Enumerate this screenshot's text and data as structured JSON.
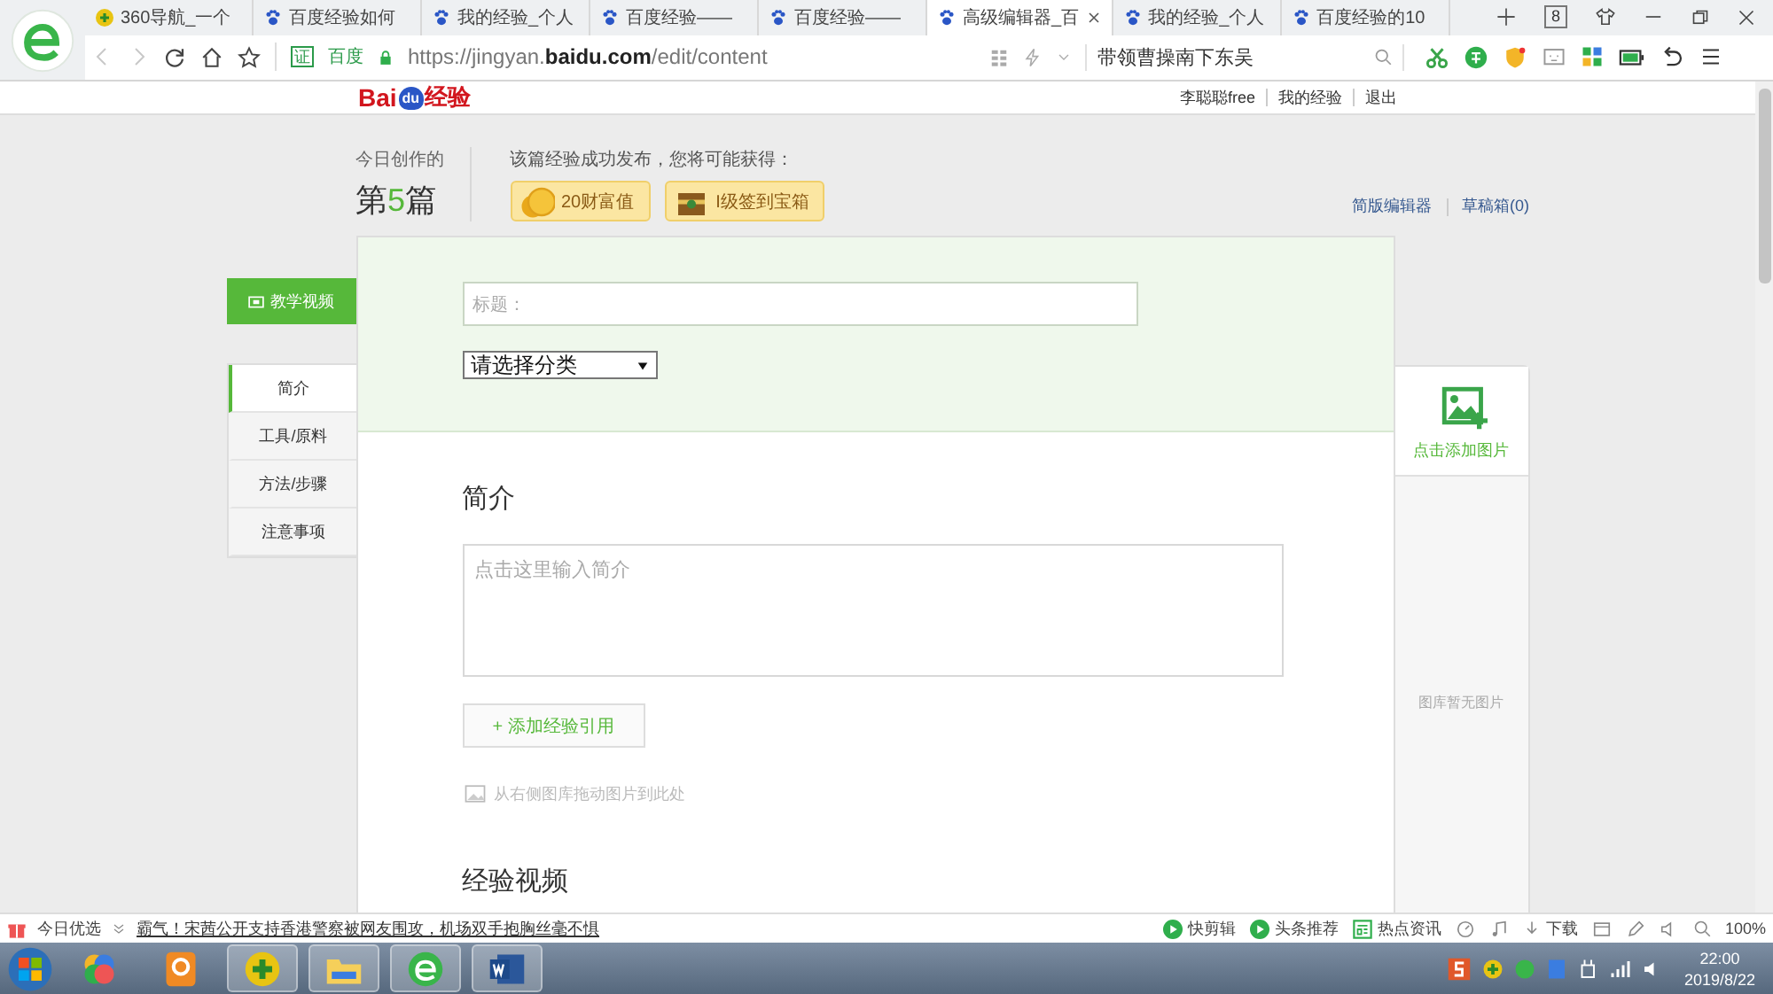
{
  "browser": {
    "tabs": [
      {
        "title": "360导航_一个",
        "selected": false,
        "kind": "navigator"
      },
      {
        "title": "百度经验如何",
        "selected": false,
        "kind": "baidu"
      },
      {
        "title": "我的经验_个人",
        "selected": false,
        "kind": "baidu"
      },
      {
        "title": "百度经验——",
        "selected": false,
        "kind": "baidu"
      },
      {
        "title": "百度经验——",
        "selected": false,
        "kind": "baidu"
      },
      {
        "title": "高级编辑器_百",
        "selected": true,
        "kind": "baidu"
      },
      {
        "title": "我的经验_个人",
        "selected": false,
        "kind": "baidu"
      },
      {
        "title": "百度经验的10",
        "selected": false,
        "kind": "baidu"
      }
    ],
    "tab_count": "8",
    "nav": {
      "back_disabled": true,
      "forward_disabled": true
    },
    "address": {
      "site_badge": "证",
      "site_name": "百度",
      "url": "https://jingyan.**baidu.com**/edit/content"
    },
    "search": {
      "value": "带领曹操南下东吴"
    }
  },
  "header": {
    "logo": {
      "left": "Bai",
      "paw": "du",
      "right": "经验"
    },
    "user_links": [
      "李聪聪free",
      "我的经验",
      "退出"
    ]
  },
  "creation": {
    "label": "今日创作的",
    "count_prefix": "第",
    "count": "5",
    "count_suffix": "篇",
    "reward_label": "该篇经验成功发布，您将可能获得：",
    "rewards": [
      {
        "kind": "coin",
        "text": "20财富值"
      },
      {
        "kind": "chest",
        "text": "I级签到宝箱"
      }
    ],
    "editor_links": [
      "简版编辑器",
      "草稿箱(0)"
    ]
  },
  "sidebar": {
    "video_button": "教学视频",
    "sections": [
      {
        "label": "简介",
        "selected": true
      },
      {
        "label": "工具/原料",
        "selected": false
      },
      {
        "label": "方法/步骤",
        "selected": false
      },
      {
        "label": "注意事项",
        "selected": false
      }
    ]
  },
  "editor": {
    "title_placeholder": "标题：",
    "category": "请选择分类",
    "section_heading": "简介",
    "intro_placeholder": "点击这里输入简介",
    "add_reference": "+ 添加经验引用",
    "drag_hint": "从右侧图库拖动图片到此处",
    "next_heading": "经验视频"
  },
  "gallery": {
    "add_label": "点击添加图片",
    "empty": "图库暂无图片"
  },
  "status_bar": {
    "label": "今日优选",
    "headline": "霸气！宋茜公开支持香港警察被网友围攻，机场双手抱胸丝毫不惧",
    "items": [
      {
        "kind": "play",
        "text": "快剪辑"
      },
      {
        "kind": "play",
        "text": "头条推荐"
      },
      {
        "kind": "news",
        "text": "热点资讯"
      }
    ],
    "download": "下载",
    "zoom": "100%"
  },
  "taskbar": {
    "time": "22:00",
    "date": "2019/8/22"
  }
}
